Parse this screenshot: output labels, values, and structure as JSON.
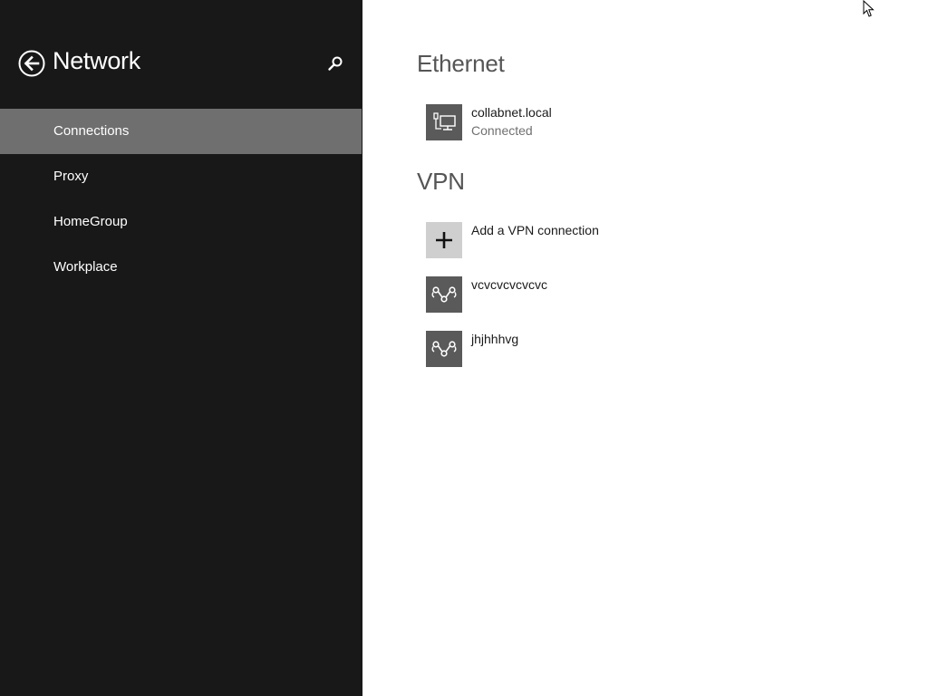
{
  "sidebar": {
    "title": "Network",
    "back_icon": "back-arrow-circle-icon",
    "search_icon": "search-icon",
    "items": [
      {
        "label": "Connections",
        "selected": true
      },
      {
        "label": "Proxy",
        "selected": false
      },
      {
        "label": "HomeGroup",
        "selected": false
      },
      {
        "label": "Workplace",
        "selected": false
      }
    ]
  },
  "main": {
    "ethernet": {
      "title": "Ethernet",
      "connections": [
        {
          "name": "collabnet.local",
          "status": "Connected",
          "icon": "ethernet-network-icon"
        }
      ]
    },
    "vpn": {
      "title": "VPN",
      "add_label": "Add a VPN connection",
      "add_icon": "plus-icon",
      "connections": [
        {
          "name": "vcvcvcvcvcvc",
          "icon": "vpn-link-icon"
        },
        {
          "name": "jhjhhhvg",
          "icon": "vpn-link-icon"
        }
      ]
    }
  },
  "colors": {
    "sidebar_bg": "#181818",
    "selected_item_bg": "#6f6f6f",
    "tile_dark": "#5a5a5a",
    "tile_light": "#cfcfcf"
  }
}
